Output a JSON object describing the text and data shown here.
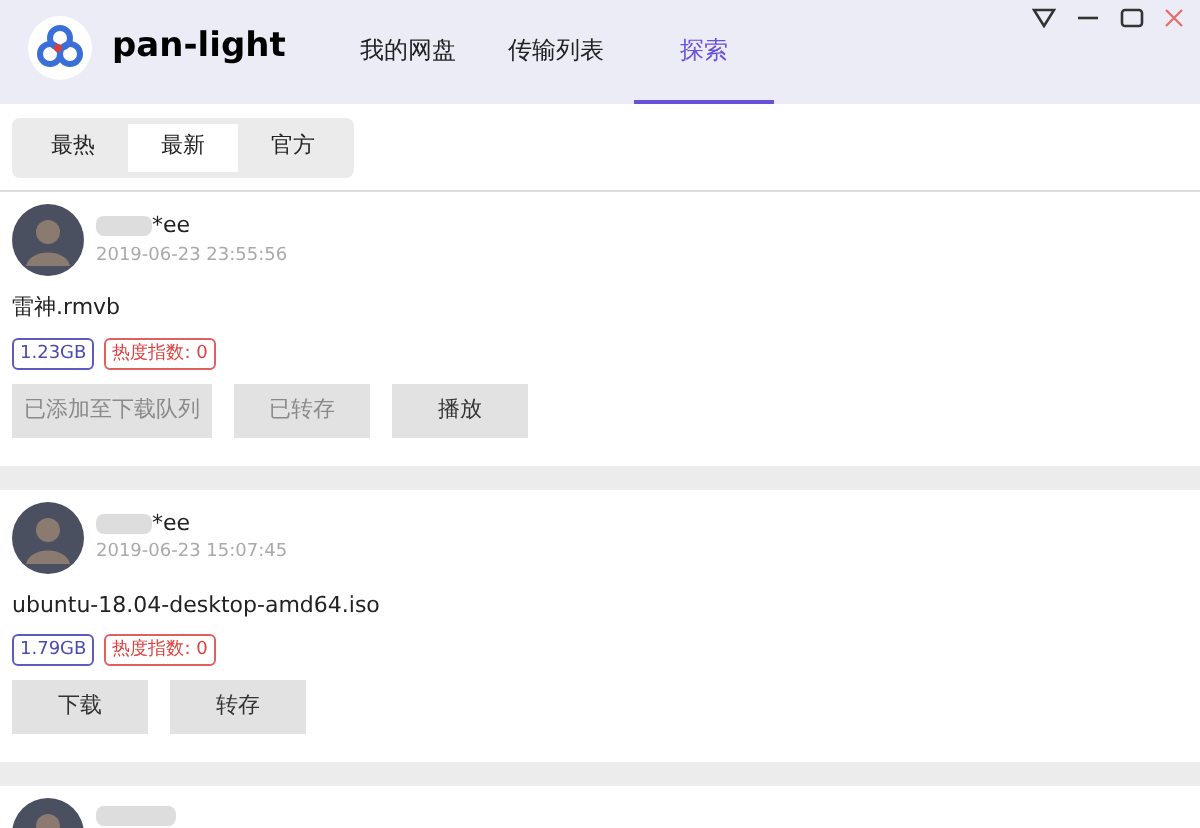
{
  "app": {
    "name": "pan-light"
  },
  "tabs": [
    {
      "label": "我的网盘",
      "selected": false
    },
    {
      "label": "传输列表",
      "selected": false
    },
    {
      "label": "探索",
      "selected": true
    }
  ],
  "sub_tabs": [
    {
      "label": "最热",
      "selected": false
    },
    {
      "label": "最新",
      "selected": true
    },
    {
      "label": "官方",
      "selected": false
    }
  ],
  "posts": [
    {
      "user": "*ee",
      "time": "2019-06-23 23:55:56",
      "file": "雷神.rmvb",
      "size": "1.23GB",
      "heat": "热度指数: 0",
      "buttons": [
        {
          "label": "已添加至下载队列",
          "disabled": true
        },
        {
          "label": "已转存",
          "disabled": true
        },
        {
          "label": "播放",
          "disabled": false
        }
      ]
    },
    {
      "user": "*ee",
      "time": "2019-06-23 15:07:45",
      "file": "ubuntu-18.04-desktop-amd64.iso",
      "size": "1.79GB",
      "heat": "热度指数: 0",
      "buttons": [
        {
          "label": "下载",
          "disabled": false
        },
        {
          "label": "转存",
          "disabled": false
        }
      ]
    }
  ]
}
